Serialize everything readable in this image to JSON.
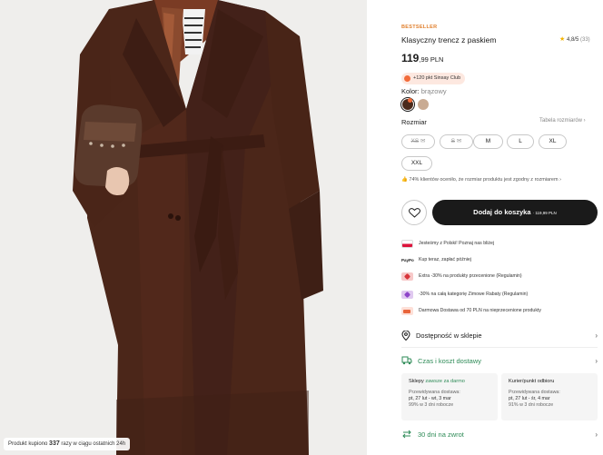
{
  "photo": {
    "banner_prefix": "Produkt kupiono",
    "banner_count": "337",
    "banner_suffix": "razy w ciągu ostatnich 24h"
  },
  "product": {
    "badge": "BESTSELLER",
    "title": "Klasyczny trencz z paskiem",
    "rating_value": "4,8/5",
    "rating_count": "(33)",
    "price_main": "119",
    "price_rest": ",99 PLN",
    "club_text": "+120 pkt Sinsay Club"
  },
  "color": {
    "label": "Kolor:",
    "value": "brązowy",
    "swatches": [
      "#4a2a1c",
      "#c9ab93"
    ]
  },
  "sizes": {
    "label": "Rozmiar",
    "table_link": "Tabela rozmiarów ›",
    "options": [
      {
        "label": "XS",
        "available": false
      },
      {
        "label": "S",
        "available": false
      },
      {
        "label": "M",
        "available": true
      },
      {
        "label": "L",
        "available": true
      },
      {
        "label": "XL",
        "available": true
      },
      {
        "label": "XXL",
        "available": true
      }
    ],
    "fit_note": "74% klientów oceniło, że rozmiar produktu jest zgodny z rozmiarem ›"
  },
  "actions": {
    "cart_label": "Dodaj do koszyka",
    "cart_price": "· 119,99 PLN"
  },
  "perks": [
    "Jesteśmy z Polski! Poznaj nas bliżej",
    "Kup teraz, zapłać później",
    "Extra -30% na produkty przecenione (Regulamin)",
    "-30% na całą kategorię Zimowe Rabaty (Regulamin)",
    "Darmowa Dostawa od 70 PLN na nieprzecenione produkty"
  ],
  "paypo_text": "PayPo",
  "sections": {
    "availability": "Dostępność w sklepie",
    "delivery": "Czas i koszt dostawy",
    "returns": "30 dni na zwrot",
    "chevron": "›"
  },
  "delivery_cards": [
    {
      "head": "Sklepy",
      "head_accent": "zawsze za darmo",
      "line1": "Przewidywana dostawa:",
      "line2": "pt, 27 lut - wt, 3 mar",
      "line3": "99% w 3 dni robocze"
    },
    {
      "head": "Kurier/punkt odbioru",
      "head_accent": "",
      "line1": "Przewidywana dostawa:",
      "line2": "pt, 27 lut - śr, 4 mar",
      "line3": "91% w 3 dni robocze"
    }
  ]
}
